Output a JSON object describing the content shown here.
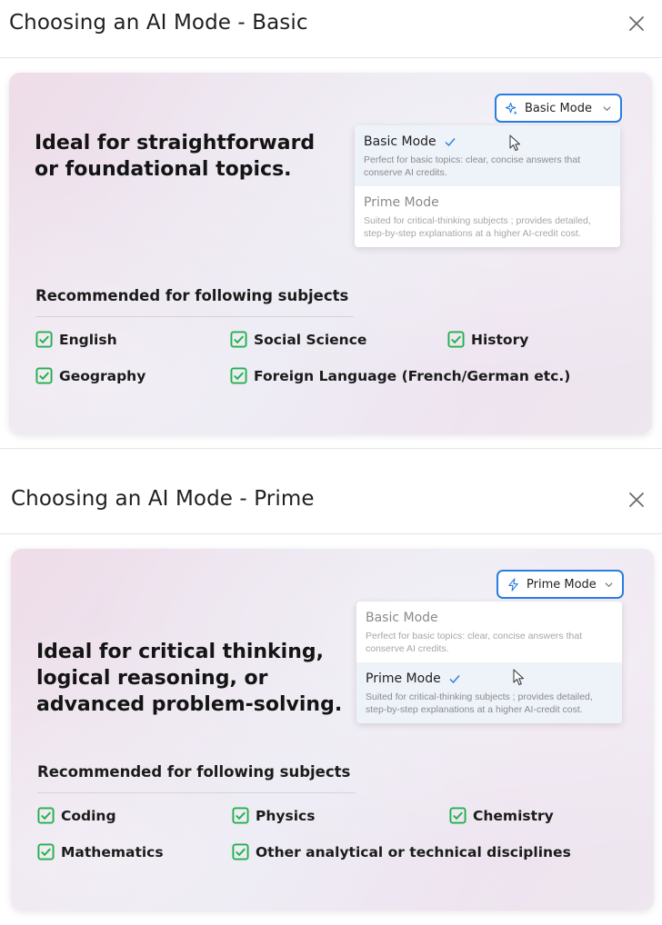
{
  "panels": [
    {
      "title": "Choosing an AI Mode - Basic",
      "headline": "Ideal for straightforward or foundational topics.",
      "select_label": "Basic Mode",
      "select_icon": "sparkle-icon",
      "menu": {
        "basic_title": "Basic Mode",
        "basic_desc": "Perfect for basic topics: clear, concise answers that conserve AI credits.",
        "prime_title": "Prime Mode",
        "prime_desc": "Suited for critical-thinking subjects ; provides detailed, step-by-step explanations at a higher AI-credit cost.",
        "selected": "Basic Mode"
      },
      "recommended_title": "Recommended for following subjects",
      "subjects": [
        "English",
        "Social Science",
        "History",
        "Geography",
        "Foreign Language (French/German etc.)"
      ]
    },
    {
      "title": "Choosing an AI Mode - Prime",
      "headline": "Ideal for critical thinking, logical reasoning, or advanced problem-solving.",
      "select_label": "Prime Mode",
      "select_icon": "lightning-icon",
      "menu": {
        "basic_title": "Basic Mode",
        "basic_desc": "Perfect for basic topics: clear, concise answers that conserve AI credits.",
        "prime_title": "Prime Mode",
        "prime_desc": "Suited for critical-thinking subjects ; provides detailed, step-by-step explanations at a higher AI-credit cost.",
        "selected": "Prime Mode"
      },
      "recommended_title": "Recommended for following subjects",
      "subjects": [
        "Coding",
        "Physics",
        "Chemistry",
        "Mathematics",
        "Other analytical or technical disciplines"
      ]
    }
  ],
  "colors": {
    "accent": "#2a7de1",
    "check_green": "#22b14c",
    "active_item_bg": "#eef2f9"
  }
}
